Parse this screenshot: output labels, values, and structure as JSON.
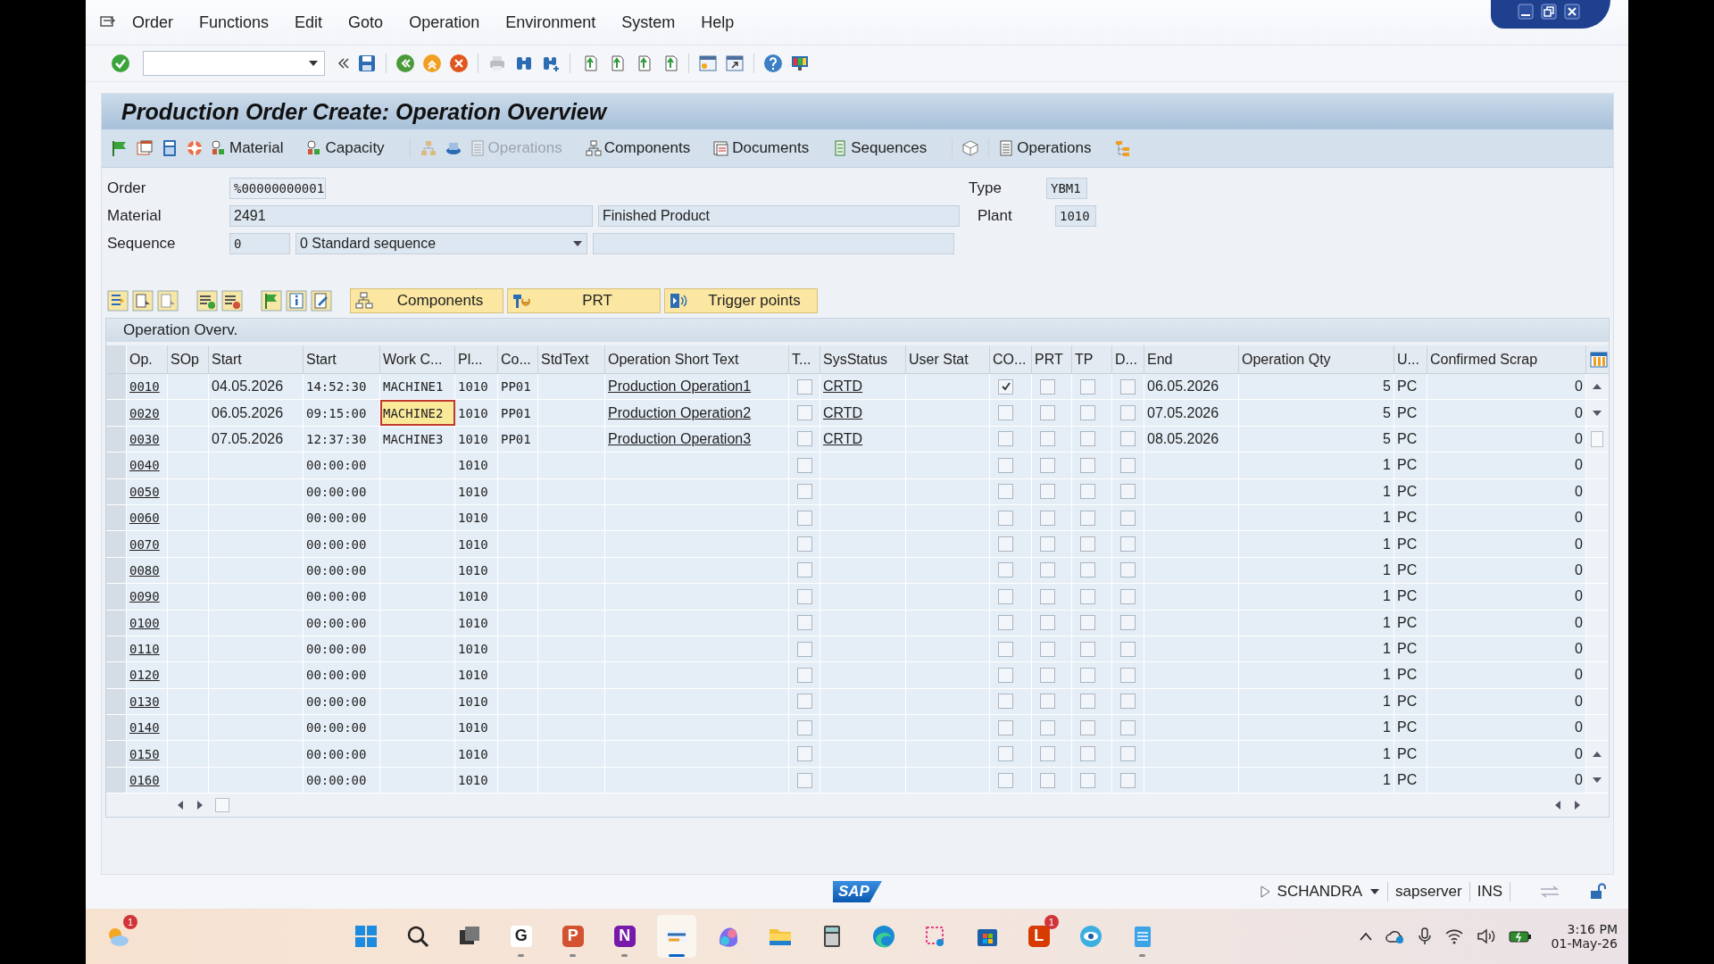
{
  "menu": [
    "Order",
    "Functions",
    "Edit",
    "Goto",
    "Operation",
    "Environment",
    "System",
    "Help"
  ],
  "title": "Production Order Create: Operation Overview",
  "app_toolbar": [
    {
      "label": "Material",
      "disabled": false
    },
    {
      "label": "Capacity",
      "disabled": false
    },
    {
      "label": "Operations",
      "disabled": true
    },
    {
      "label": "Components",
      "disabled": false
    },
    {
      "label": "Documents",
      "disabled": false
    },
    {
      "label": "Sequences",
      "disabled": false
    },
    {
      "label": "Operations",
      "disabled": false
    }
  ],
  "header": {
    "order": {
      "label": "Order",
      "value": "%00000000001"
    },
    "material": {
      "label": "Material",
      "value": "2491",
      "description": "Finished Product"
    },
    "sequence": {
      "label": "Sequence",
      "value": "0",
      "option": "0 Standard sequence"
    },
    "type": {
      "label": "Type",
      "value": "YBM1"
    },
    "plant": {
      "label": "Plant",
      "value": "1010"
    }
  },
  "table_toolbar": [
    "Components",
    "PRT",
    "Trigger points"
  ],
  "table": {
    "title": "Operation Overv.",
    "columns": [
      "Op.",
      "SOp",
      "Start",
      "Start",
      "Work C...",
      "Pl...",
      "Co...",
      "StdText",
      "Operation Short Text",
      "T...",
      "SysStatus",
      "User Stat",
      "CO...",
      "PRT",
      "TP",
      "D...",
      "End",
      "Operation Qty",
      "U...",
      "Confirmed Scrap"
    ],
    "rows": [
      {
        "op": "0010",
        "start_date": "04.05.2026",
        "start_time": "14:52:30",
        "work_center": "MACHINE1",
        "focused": false,
        "plant": "1010",
        "control_key": "PP01",
        "short_text": "Production Operation1",
        "t": false,
        "sys_status": "CRTD",
        "co": true,
        "prt": false,
        "tp": false,
        "d": false,
        "end": "06.05.2026",
        "qty": "5",
        "unit": "PC",
        "scrap": "0"
      },
      {
        "op": "0020",
        "start_date": "06.05.2026",
        "start_time": "09:15:00",
        "work_center": "MACHINE2",
        "focused": true,
        "plant": "1010",
        "control_key": "PP01",
        "short_text": "Production Operation2",
        "t": false,
        "sys_status": "CRTD",
        "co": false,
        "prt": false,
        "tp": false,
        "d": false,
        "end": "07.05.2026",
        "qty": "5",
        "unit": "PC",
        "scrap": "0"
      },
      {
        "op": "0030",
        "start_date": "07.05.2026",
        "start_time": "12:37:30",
        "work_center": "MACHINE3",
        "focused": false,
        "plant": "1010",
        "control_key": "PP01",
        "short_text": "Production Operation3",
        "t": false,
        "sys_status": "CRTD",
        "co": false,
        "prt": false,
        "tp": false,
        "d": false,
        "end": "08.05.2026",
        "qty": "5",
        "unit": "PC",
        "scrap": "0"
      },
      {
        "op": "0040",
        "start_time": "00:00:00",
        "focused": false,
        "plant": "1010",
        "t": false,
        "co": false,
        "prt": false,
        "tp": false,
        "d": false,
        "qty": "1",
        "unit": "PC",
        "scrap": "0"
      },
      {
        "op": "0050",
        "start_time": "00:00:00",
        "focused": false,
        "plant": "1010",
        "t": false,
        "co": false,
        "prt": false,
        "tp": false,
        "d": false,
        "qty": "1",
        "unit": "PC",
        "scrap": "0"
      },
      {
        "op": "0060",
        "start_time": "00:00:00",
        "focused": false,
        "plant": "1010",
        "t": false,
        "co": false,
        "prt": false,
        "tp": false,
        "d": false,
        "qty": "1",
        "unit": "PC",
        "scrap": "0"
      },
      {
        "op": "0070",
        "start_time": "00:00:00",
        "focused": false,
        "plant": "1010",
        "t": false,
        "co": false,
        "prt": false,
        "tp": false,
        "d": false,
        "qty": "1",
        "unit": "PC",
        "scrap": "0"
      },
      {
        "op": "0080",
        "start_time": "00:00:00",
        "focused": false,
        "plant": "1010",
        "t": false,
        "co": false,
        "prt": false,
        "tp": false,
        "d": false,
        "qty": "1",
        "unit": "PC",
        "scrap": "0"
      },
      {
        "op": "0090",
        "start_time": "00:00:00",
        "focused": false,
        "plant": "1010",
        "t": false,
        "co": false,
        "prt": false,
        "tp": false,
        "d": false,
        "qty": "1",
        "unit": "PC",
        "scrap": "0"
      },
      {
        "op": "0100",
        "start_time": "00:00:00",
        "focused": false,
        "plant": "1010",
        "t": false,
        "co": false,
        "prt": false,
        "tp": false,
        "d": false,
        "qty": "1",
        "unit": "PC",
        "scrap": "0"
      },
      {
        "op": "0110",
        "start_time": "00:00:00",
        "focused": false,
        "plant": "1010",
        "t": false,
        "co": false,
        "prt": false,
        "tp": false,
        "d": false,
        "qty": "1",
        "unit": "PC",
        "scrap": "0"
      },
      {
        "op": "0120",
        "start_time": "00:00:00",
        "focused": false,
        "plant": "1010",
        "t": false,
        "co": false,
        "prt": false,
        "tp": false,
        "d": false,
        "qty": "1",
        "unit": "PC",
        "scrap": "0"
      },
      {
        "op": "0130",
        "start_time": "00:00:00",
        "focused": false,
        "plant": "1010",
        "t": false,
        "co": false,
        "prt": false,
        "tp": false,
        "d": false,
        "qty": "1",
        "unit": "PC",
        "scrap": "0"
      },
      {
        "op": "0140",
        "start_time": "00:00:00",
        "focused": false,
        "plant": "1010",
        "t": false,
        "co": false,
        "prt": false,
        "tp": false,
        "d": false,
        "qty": "1",
        "unit": "PC",
        "scrap": "0"
      },
      {
        "op": "0150",
        "start_time": "00:00:00",
        "focused": false,
        "plant": "1010",
        "t": false,
        "co": false,
        "prt": false,
        "tp": false,
        "d": false,
        "qty": "1",
        "unit": "PC",
        "scrap": "0"
      },
      {
        "op": "0160",
        "start_time": "00:00:00",
        "focused": false,
        "plant": "1010",
        "t": false,
        "co": false,
        "prt": false,
        "tp": false,
        "d": false,
        "qty": "1",
        "unit": "PC",
        "scrap": "0"
      }
    ]
  },
  "status_bar": {
    "logo": "SAP",
    "user": "SCHANDRA",
    "server": "sapserver",
    "mode": "INS"
  },
  "taskbar": {
    "apps": [
      {
        "kind": "weather",
        "badge": "1"
      },
      {
        "kind": "start"
      },
      {
        "kind": "search"
      },
      {
        "kind": "taskview"
      },
      {
        "kind": "letter",
        "glyph": "G",
        "running": true,
        "active": false
      },
      {
        "kind": "powerpoint",
        "glyph": "P",
        "running": true,
        "active": false
      },
      {
        "kind": "onenote",
        "glyph": "N",
        "running": true,
        "active": false
      },
      {
        "kind": "sap",
        "running": true,
        "active": true
      },
      {
        "kind": "copilot",
        "running": false,
        "active": false
      },
      {
        "kind": "folder",
        "running": false,
        "active": false
      },
      {
        "kind": "calculator",
        "running": false,
        "active": false
      },
      {
        "kind": "edge",
        "running": false,
        "active": false
      },
      {
        "kind": "snip",
        "running": false,
        "active": false
      },
      {
        "kind": "store",
        "running": false,
        "active": false
      },
      {
        "kind": "redapp",
        "glyph": "L",
        "badge": "1",
        "running": false,
        "active": false
      },
      {
        "kind": "eye",
        "running": false,
        "active": false
      },
      {
        "kind": "notepad",
        "running": true,
        "active": false
      }
    ],
    "time": "3:16 PM",
    "date": "01-May-26"
  }
}
